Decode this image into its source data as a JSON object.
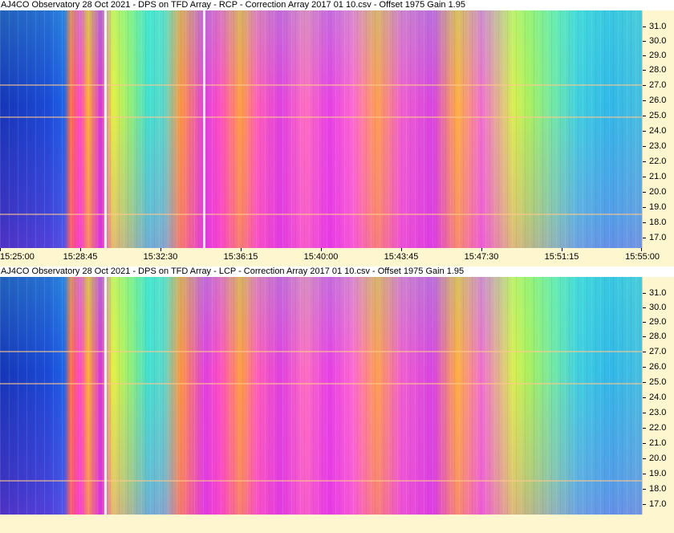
{
  "panels": [
    {
      "title": "AJ4CO Observatory 28 Oct 2021  -  DPS on TFD Array  -  RCP  -  Correction Array 2017 01 10.csv  -  Offset 1975  Gain 1.95",
      "y_labels": [
        "31.0",
        "30.0",
        "29.0",
        "28.0",
        "27.0",
        "26.0",
        "25.0",
        "24.0",
        "23.0",
        "22.0",
        "21.0",
        "20.0",
        "19.0",
        "18.0",
        "17.0"
      ],
      "x_labels": [
        "15:25:00",
        "15:28:45",
        "15:32:30",
        "15:36:15",
        "15:40:00",
        "15:43:45",
        "15:47:30",
        "15:51:15",
        "15:55:00"
      ]
    },
    {
      "title": "AJ4CO Observatory 28 Oct 2021  -  DPS on TFD Array  -  LCP  -  Correction Array 2017 01 10.csv  -  Offset 1975  Gain 1.95",
      "y_labels": [
        "31.0",
        "30.0",
        "29.0",
        "28.0",
        "27.0",
        "26.0",
        "25.0",
        "24.0",
        "23.0",
        "22.0",
        "21.0",
        "20.0",
        "19.0",
        "18.0",
        "17.0"
      ],
      "x_labels": []
    }
  ]
}
